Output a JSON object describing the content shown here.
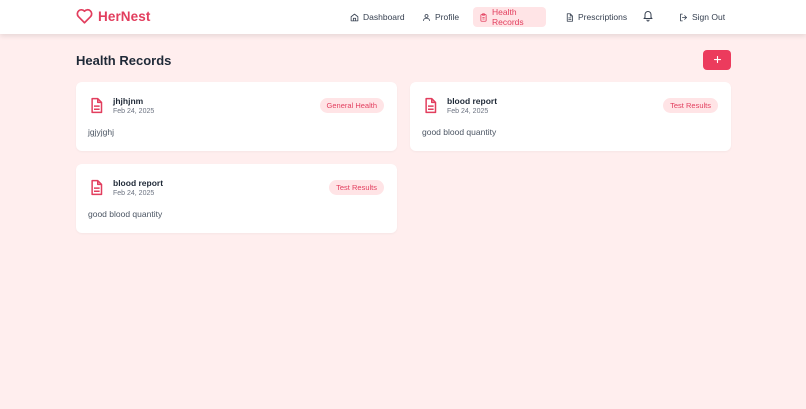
{
  "app": {
    "name": "HerNest"
  },
  "nav": {
    "dashboard": "Dashboard",
    "profile": "Profile",
    "health_records": "Health Records",
    "prescriptions": "Prescriptions",
    "sign_out": "Sign Out",
    "active": "health_records"
  },
  "main": {
    "title": "Health Records",
    "add_label": "+"
  },
  "records": [
    {
      "title": "jhjhjnm",
      "date": "Feb 24, 2025",
      "category": "General Health",
      "description": "jgjyjghj"
    },
    {
      "title": "blood report",
      "date": "Feb 24, 2025",
      "category": "Test Results",
      "description": "good blood quantity"
    },
    {
      "title": "blood report",
      "date": "Feb 24, 2025",
      "category": "Test Results",
      "description": "good blood quantity"
    }
  ],
  "colors": {
    "accent": "#e23e5e",
    "background": "#ffeeee",
    "badge_bg": "#ffe4e6"
  },
  "icons": {
    "logo": "heart-icon",
    "dashboard": "home-icon",
    "profile": "user-icon",
    "health_records": "clipboard-icon",
    "prescriptions": "file-text-icon",
    "notifications": "bell-icon",
    "sign_out": "log-out-icon",
    "record": "file-text-icon"
  }
}
